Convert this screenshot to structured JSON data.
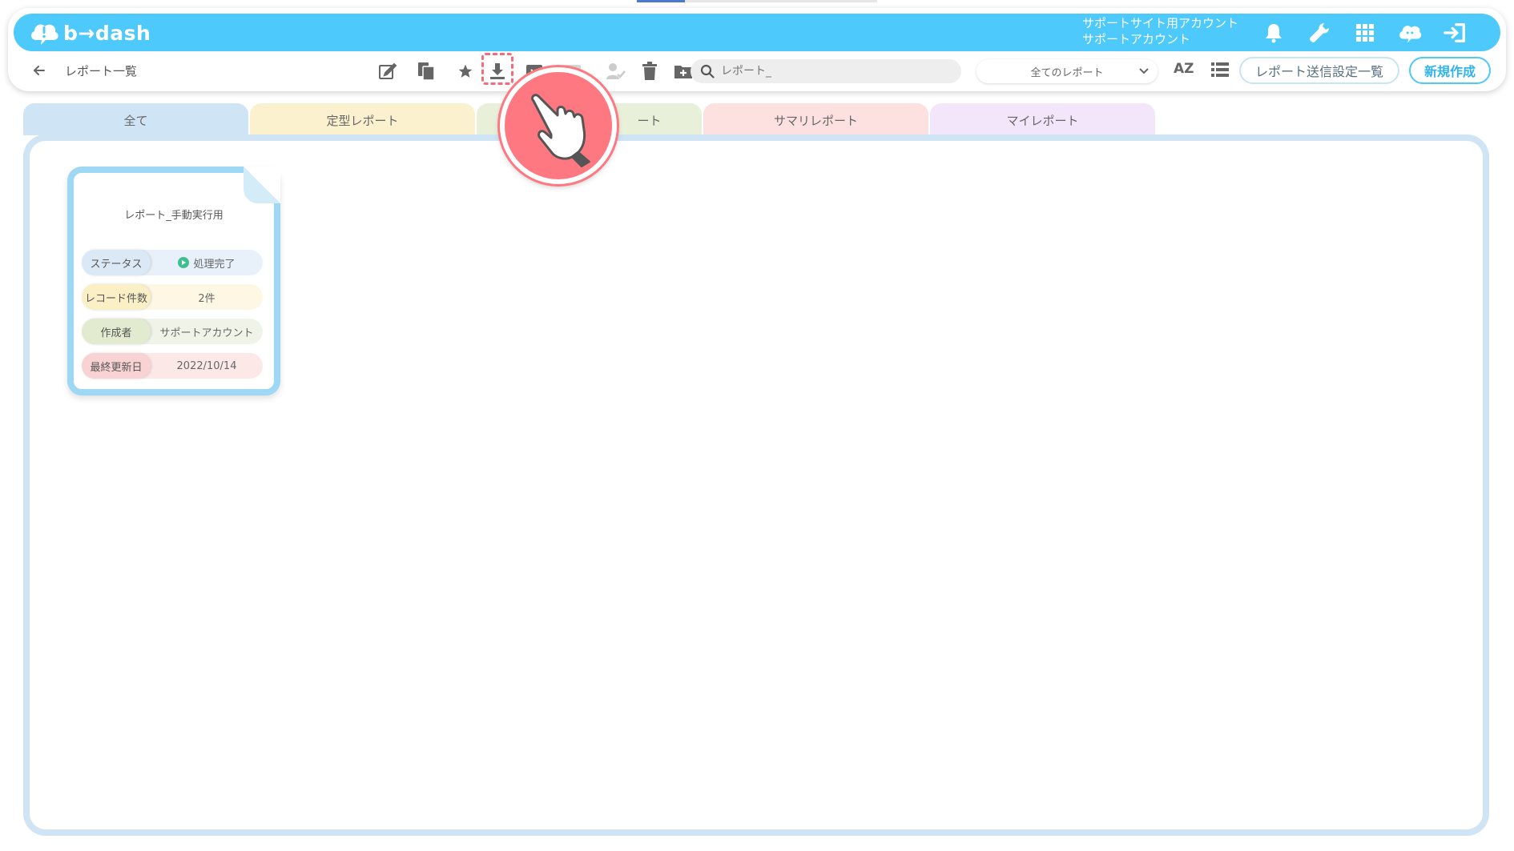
{
  "app": {
    "logo_text": "b→dash",
    "account_line1": "サポートサイト用アカウント",
    "account_line2": "サポートアカウント",
    "header_icons": [
      "bell-icon",
      "wrench-icon",
      "grid-icon",
      "mascot-icon",
      "logout-icon"
    ]
  },
  "toolbar": {
    "page_title": "レポート一覧",
    "tools": [
      "edit-icon",
      "copy-icon",
      "star-icon",
      "download-icon",
      "archive-icon",
      "disabled-icon",
      "user-check-icon",
      "trash-icon",
      "folder-add-icon"
    ],
    "search_placeholder": "レポート_",
    "filter_selected": "全てのレポート",
    "sort_label": "AZ",
    "report_send_settings_label": "レポート送信設定一覧",
    "new_button_label": "新規作成"
  },
  "tabs": [
    {
      "label": "全て",
      "active": true
    },
    {
      "label": "定型レポート",
      "active": false
    },
    {
      "label": "ート",
      "active": false
    },
    {
      "label": "サマリレポート",
      "active": false
    },
    {
      "label": "マイレポート",
      "active": false
    }
  ],
  "card": {
    "title": "レポート_手動実行用",
    "rows": [
      {
        "label": "ステータス",
        "value": "処理完了"
      },
      {
        "label": "レコード件数",
        "value": "2件"
      },
      {
        "label": "作成者",
        "value": "サポートアカウント"
      },
      {
        "label": "最終更新日",
        "value": "2022/10/14"
      }
    ]
  },
  "colors": {
    "brand": "#4dc9fb",
    "highlight": "#f46b7a",
    "status_ok": "#3fc08e"
  }
}
